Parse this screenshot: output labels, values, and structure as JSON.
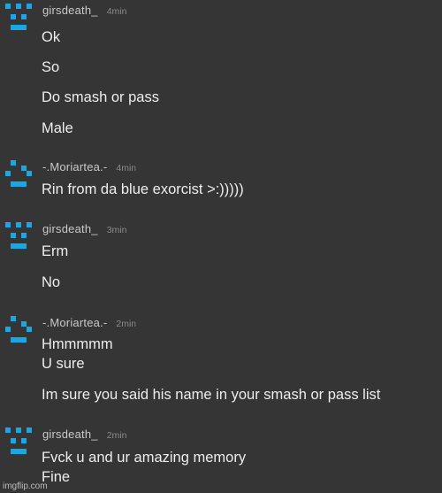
{
  "colors": {
    "background": "#353535",
    "avatar": "#1aa7e6",
    "username": "#c9c9c9",
    "timestamp": "#8a8a8a",
    "message_text": "#ededed"
  },
  "messages": [
    {
      "username": "girsdeath_",
      "time": "4min",
      "avatar_icon": "pixel-face-icon",
      "lines": [
        "Ok",
        "So",
        "Do smash or pass",
        "Male"
      ]
    },
    {
      "username": "-.Moriartea.-",
      "time": "4min",
      "avatar_icon": "pixel-smirk-face-icon",
      "lines": [
        "Rin from da blue exorcist >:)))))"
      ]
    },
    {
      "username": "girsdeath_",
      "time": "3min",
      "avatar_icon": "pixel-face-icon",
      "lines": [
        "Erm",
        "No"
      ]
    },
    {
      "username": "-.Moriartea.-",
      "time": "2min",
      "avatar_icon": "pixel-smirk-face-icon",
      "lines": [
        "Hmmmmm",
        "U sure",
        "Im sure you said his name in your smash or pass list"
      ]
    },
    {
      "username": "girsdeath_",
      "time": "2min",
      "avatar_icon": "pixel-face-icon",
      "lines": [
        "Fvck u and ur amazing memory",
        "Fine"
      ]
    }
  ],
  "watermark": "imgflip.com"
}
